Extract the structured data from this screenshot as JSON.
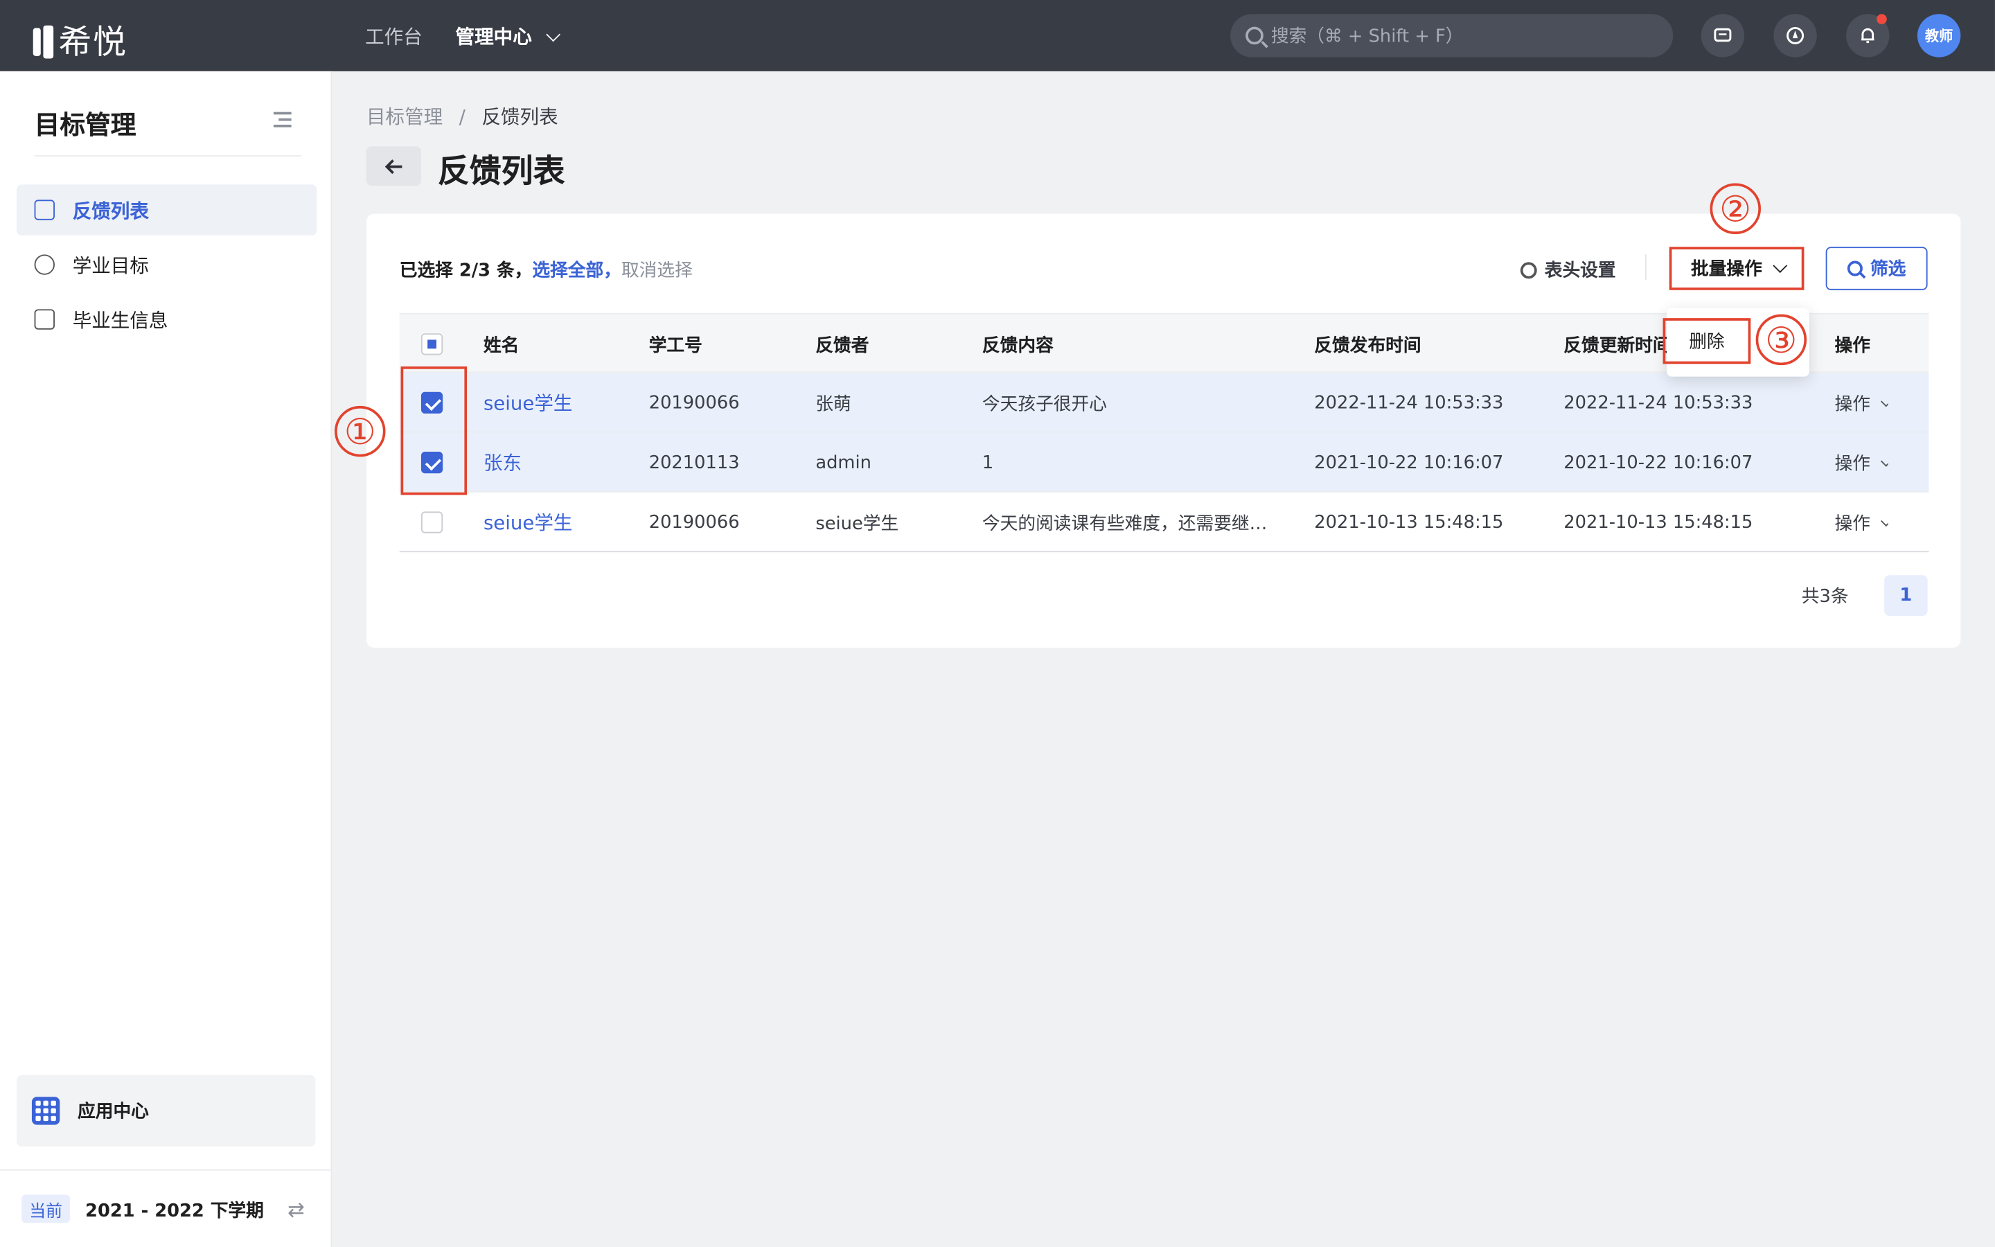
{
  "header": {
    "logo_text": "希悦",
    "nav": [
      "工作台",
      "管理中心"
    ],
    "search_placeholder": "搜索（⌘ + Shift + F）",
    "avatar_label": "教师"
  },
  "sidebar": {
    "title": "目标管理",
    "items": [
      {
        "label": "反馈列表",
        "active": true
      },
      {
        "label": "学业目标",
        "active": false
      },
      {
        "label": "毕业生信息",
        "active": false
      }
    ],
    "app_center": "应用中心",
    "term_tag": "当前",
    "term_text": "2021 - 2022 下学期"
  },
  "breadcrumb": {
    "root": "目标管理",
    "sep": "/",
    "current": "反馈列表"
  },
  "page_title": "反馈列表",
  "toolbar": {
    "selected_prefix": "已选择 2/3 条，",
    "select_all": "选择全部，",
    "deselect": "取消选择",
    "header_settings": "表头设置",
    "batch_ops": "批量操作",
    "filter": "筛选",
    "dropdown_delete": "删除"
  },
  "table": {
    "columns": [
      "姓名",
      "学工号",
      "反馈者",
      "反馈内容",
      "反馈发布时间",
      "反馈更新时间",
      "操作"
    ],
    "rows": [
      {
        "checked": true,
        "name": "seiue学生",
        "id": "20190066",
        "by": "张萌",
        "content": "今天孩子很开心",
        "published": "2022-11-24 10:53:33",
        "updated": "2022-11-24 10:53:33",
        "op": "操作"
      },
      {
        "checked": true,
        "name": "张东",
        "id": "20210113",
        "by": "admin",
        "content": "1",
        "published": "2021-10-22 10:16:07",
        "updated": "2021-10-22 10:16:07",
        "op": "操作"
      },
      {
        "checked": false,
        "name": "seiue学生",
        "id": "20190066",
        "by": "seiue学生",
        "content": "今天的阅读课有些难度，还需要继…",
        "published": "2021-10-13 15:48:15",
        "updated": "2021-10-13 15:48:15",
        "op": "操作"
      }
    ]
  },
  "pager": {
    "total": "共3条",
    "page": "1"
  },
  "annotations": [
    "①",
    "②",
    "③"
  ],
  "colors": {
    "accent": "#3b63d6",
    "highlight": "#e2432e",
    "topbar": "#383c45"
  }
}
